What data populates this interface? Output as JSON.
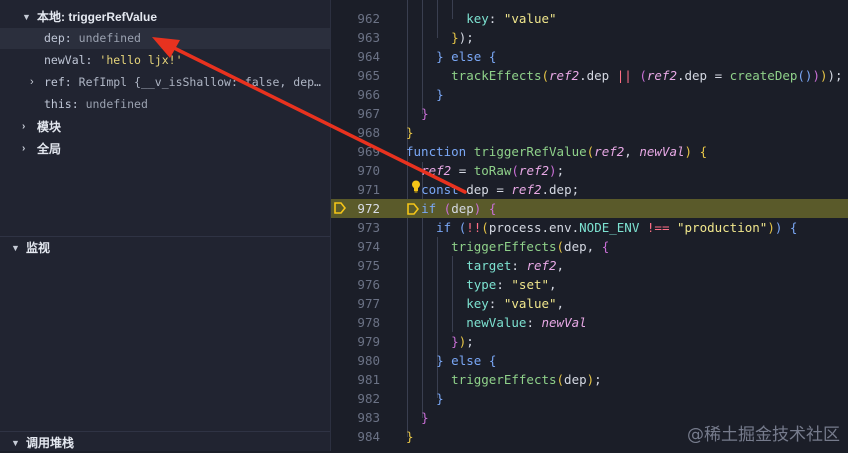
{
  "debug": {
    "local": {
      "title": "本地: triggerRefValue",
      "vars": [
        {
          "name": "dep",
          "value": "undefined"
        },
        {
          "name": "newVal",
          "value": "'hello ljx!'"
        },
        {
          "name": "ref",
          "value": "RefImpl {__v_isShallow: false, dep…"
        },
        {
          "name": "this",
          "value": "undefined"
        }
      ]
    },
    "module_title": "模块",
    "global_title": "全局",
    "watch_title": "监视",
    "callstack_title": "调用堆栈"
  },
  "editor": {
    "lines": [
      962,
      963,
      964,
      965,
      966,
      967,
      968,
      969,
      970,
      971,
      972,
      973,
      974,
      975,
      976,
      977,
      978,
      979,
      980,
      981,
      982,
      983,
      984
    ],
    "current_line": 972
  },
  "watermark": "@稀土掘金技术社区",
  "colors": {
    "accent_arrow": "#e8321f",
    "current_line_bg": "#5a5a2a",
    "breakpoint": "#f5c518"
  },
  "icons": [
    "chevron-down-icon",
    "chevron-right-icon",
    "lightbulb-icon",
    "breakpoint-icon"
  ]
}
